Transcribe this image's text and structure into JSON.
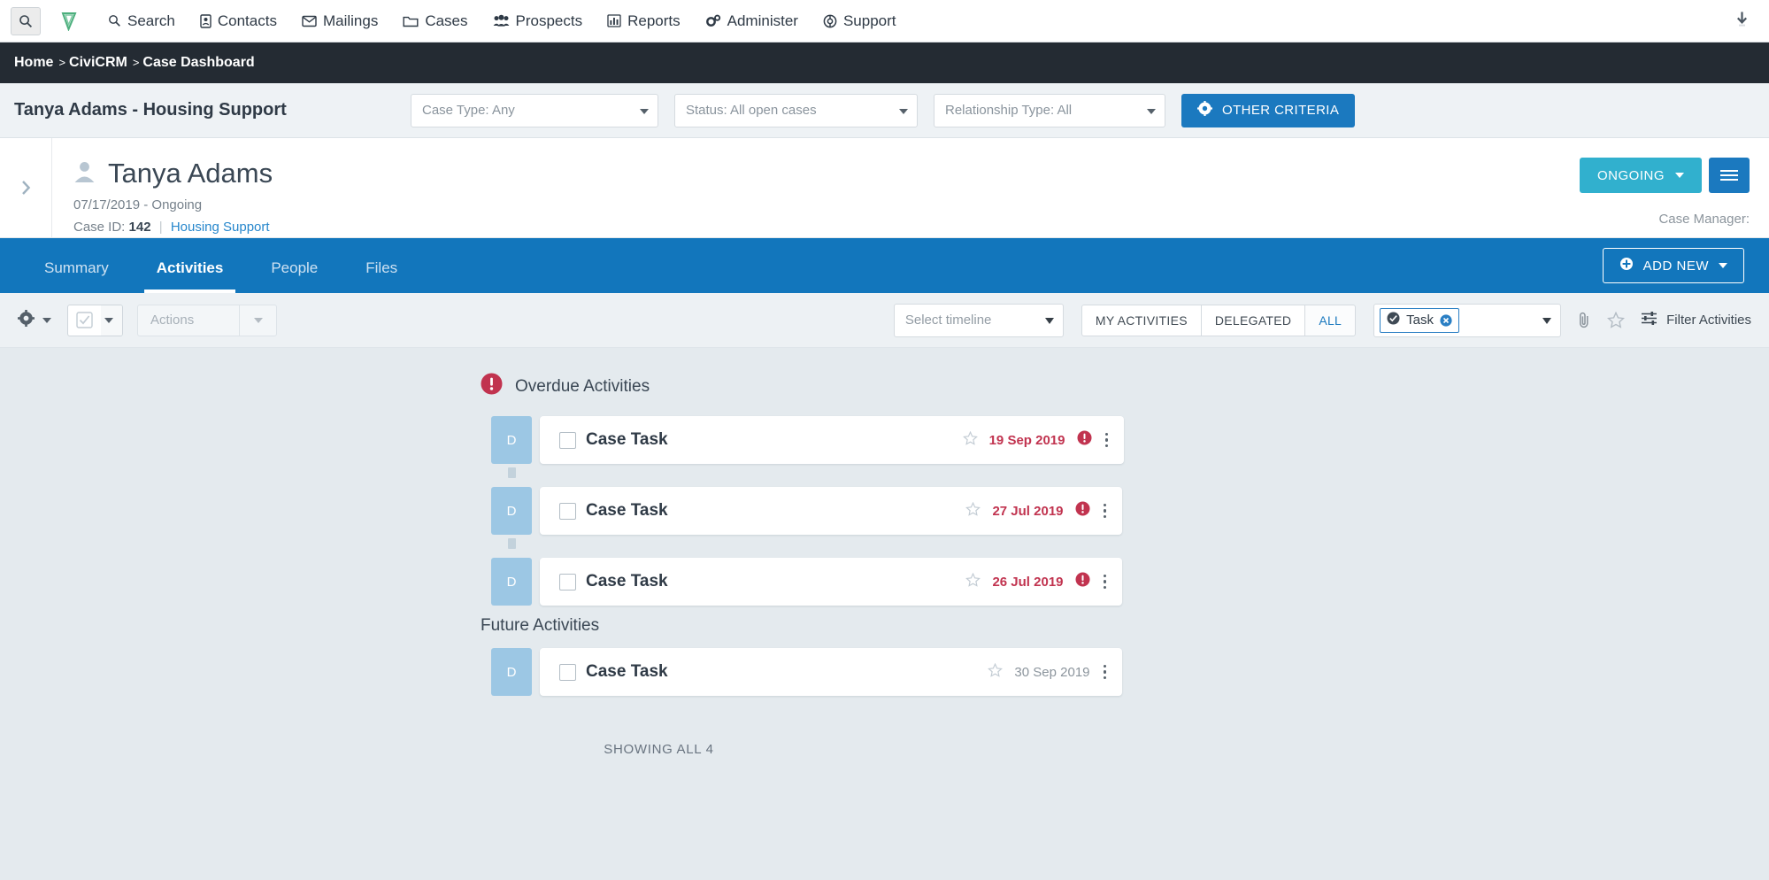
{
  "topnav": {
    "search_box_icon": "search-icon",
    "logo_icon": "civicrm-logo-icon",
    "download_icon": "download-icon",
    "items": [
      {
        "label": "Search",
        "icon": "search-icon"
      },
      {
        "label": "Contacts",
        "icon": "contacts-icon"
      },
      {
        "label": "Mailings",
        "icon": "envelope-icon"
      },
      {
        "label": "Cases",
        "icon": "folder-icon"
      },
      {
        "label": "Prospects",
        "icon": "people-group-icon"
      },
      {
        "label": "Reports",
        "icon": "bar-chart-icon"
      },
      {
        "label": "Administer",
        "icon": "gears-icon"
      },
      {
        "label": "Support",
        "icon": "lifebuoy-icon"
      }
    ]
  },
  "breadcrumb": {
    "separator": ">",
    "items": [
      "Home",
      "CiviCRM",
      "Case Dashboard"
    ]
  },
  "filterbar": {
    "case_title": "Tanya Adams - Housing Support",
    "case_type": "Case Type: Any",
    "status": "Status: All open cases",
    "relationship_type": "Relationship Type: All",
    "other_criteria_label": "OTHER CRITERIA",
    "other_criteria_icon": "gear-icon",
    "accent_color": "#1b79bf"
  },
  "case_header": {
    "expander_icon": "chevron-right-icon",
    "avatar_icon": "person-icon",
    "name": "Tanya Adams",
    "dates": "07/17/2019 - Ongoing",
    "case_id_label": "Case ID:",
    "case_id_value": "142",
    "id_divider": "|",
    "case_type_link": "Housing Support",
    "status_button": "ONGOING",
    "status_color": "#31b0ce",
    "menu_icon": "hamburger-icon",
    "case_manager_label": "Case Manager:"
  },
  "tabs": {
    "items": [
      {
        "label": "Summary",
        "active": false
      },
      {
        "label": "Activities",
        "active": true
      },
      {
        "label": "People",
        "active": false
      },
      {
        "label": "Files",
        "active": false
      }
    ],
    "add_new_label": "ADD NEW",
    "add_new_icon": "plus-circle-icon",
    "bar_color": "#1276bc"
  },
  "toolbar": {
    "gear_icon": "gear-icon",
    "select_all_icon": "checkbox-checked-icon",
    "actions_label": "Actions",
    "timeline_placeholder": "Select timeline",
    "segments": [
      {
        "label": "MY ACTIVITIES",
        "active": false
      },
      {
        "label": "DELEGATED",
        "active": false
      },
      {
        "label": "ALL",
        "active": true
      }
    ],
    "task_chip_label": "Task",
    "task_chip_icon": "check-circle-icon",
    "task_chip_remove_icon": "close-circle-icon",
    "attachment_icon": "paperclip-icon",
    "star_icon": "star-outline-icon",
    "filter_icon": "sliders-icon",
    "filter_label": "Filter Activities"
  },
  "activities": {
    "sections": [
      {
        "title": "Overdue Activities",
        "icon": "alert-circle-icon",
        "has_icon": true,
        "items": [
          {
            "tag": "D",
            "title": "Case Task",
            "date": "19 Sep 2019",
            "overdue": true,
            "width": "w-lg",
            "stub": true
          },
          {
            "tag": "D",
            "title": "Case Task",
            "date": "27 Jul 2019",
            "overdue": true,
            "width": "w-md",
            "stub": true
          },
          {
            "tag": "D",
            "title": "Case Task",
            "date": "26 Jul 2019",
            "overdue": true,
            "width": "w-md",
            "stub": false
          }
        ]
      },
      {
        "title": "Future Activities",
        "icon": "",
        "has_icon": false,
        "items": [
          {
            "tag": "D",
            "title": "Case Task",
            "date": "30 Sep 2019",
            "overdue": false,
            "width": "w-md",
            "stub": false
          }
        ]
      }
    ],
    "showing": "SHOWING ALL 4",
    "overdue_color": "#c1334f",
    "tag_color": "#9cc7e4"
  }
}
